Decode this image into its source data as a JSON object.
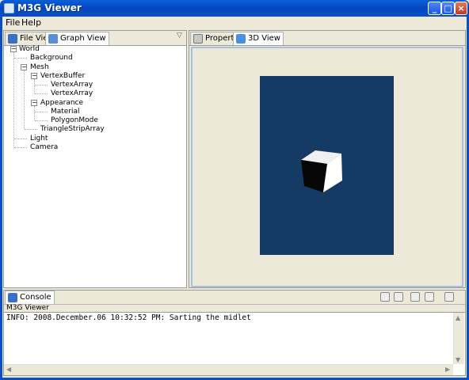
{
  "window": {
    "title": "M3G Viewer"
  },
  "titlebar": {
    "minimize": "_",
    "maximize": "□",
    "close": "×"
  },
  "menu": {
    "items": [
      {
        "label": "File"
      },
      {
        "label": "Help"
      }
    ]
  },
  "left_panel": {
    "tabs": [
      {
        "label": "File View"
      },
      {
        "label": "Graph View",
        "active": true
      }
    ],
    "view_menu_glyph": "▽",
    "tree": [
      {
        "label": "World",
        "depth": 0,
        "expanded": true
      },
      {
        "label": "Background",
        "depth": 1
      },
      {
        "label": "Mesh",
        "depth": 1,
        "expanded": true
      },
      {
        "label": "VertexBuffer",
        "depth": 2,
        "expanded": true
      },
      {
        "label": "VertexArray",
        "depth": 3
      },
      {
        "label": "VertexArray",
        "depth": 3
      },
      {
        "label": "Appearance",
        "depth": 2,
        "expanded": true
      },
      {
        "label": "Material",
        "depth": 3
      },
      {
        "label": "PolygonMode",
        "depth": 3
      },
      {
        "label": "TriangleStripArray",
        "depth": 2
      },
      {
        "label": "Light",
        "depth": 1
      },
      {
        "label": "Camera",
        "depth": 1
      }
    ]
  },
  "right_panel": {
    "tabs": [
      {
        "label": "Properties"
      },
      {
        "label": "3D View",
        "active": true
      }
    ],
    "viewport_color": "#153a64"
  },
  "console": {
    "tab_label": "Console",
    "source_label": "M3G Viewer",
    "log": "INFO: 2008.December.06 10:32:52 PM: Sarting the midlet",
    "toolbar_icons": [
      "clear-console-icon",
      "scroll-lock-icon",
      "pin-console-icon",
      "display-console-icon",
      "open-console-icon"
    ]
  },
  "colors": {
    "titlebar": "#0a4fc8",
    "chrome": "#ece9d8",
    "viewport": "#153a64"
  }
}
